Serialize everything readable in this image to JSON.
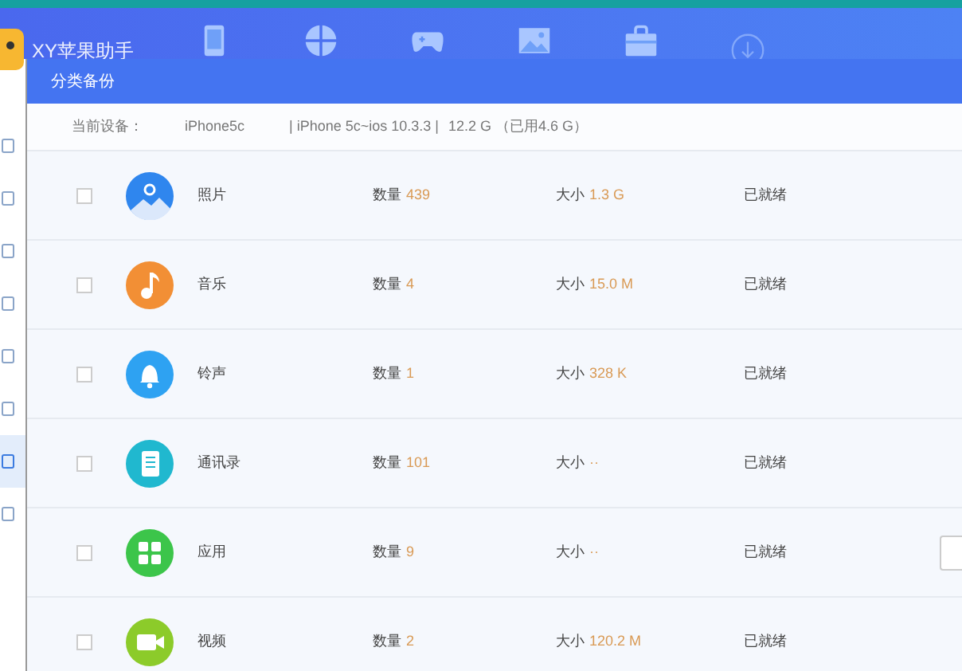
{
  "app": {
    "title": "XY苹果助手"
  },
  "toolbar": [
    {
      "kind": "device",
      "selected": false
    },
    {
      "kind": "apps",
      "selected": false
    },
    {
      "kind": "games",
      "selected": false
    },
    {
      "kind": "wallpaper",
      "selected": false
    },
    {
      "kind": "store",
      "selected": false
    },
    {
      "kind": "download",
      "selected": false
    }
  ],
  "sidebar": {
    "items": [
      {
        "selected": false
      },
      {
        "selected": false
      },
      {
        "selected": false
      },
      {
        "selected": false
      },
      {
        "selected": false
      },
      {
        "selected": false
      },
      {
        "selected": true
      },
      {
        "selected": false
      }
    ]
  },
  "dialog": {
    "title": "分类备份",
    "device": {
      "label": "当前设备：",
      "name": "iPhone5c",
      "model": "| iPhone 5c~ios 10.3.3 |",
      "storage": "12.2 G （已用4.6 G）"
    },
    "rows": [
      {
        "kind": "photo",
        "checked": false,
        "name": "照片",
        "count_label": "数量",
        "count": "439",
        "size_label": "大小",
        "size": "1.3 G",
        "status": "已就绪",
        "action_button": false
      },
      {
        "kind": "music",
        "checked": false,
        "name": "音乐",
        "count_label": "数量",
        "count": "4",
        "size_label": "大小",
        "size": "15.0 M",
        "status": "已就绪",
        "action_button": false
      },
      {
        "kind": "ringtone",
        "checked": false,
        "name": "铃声",
        "count_label": "数量",
        "count": "1",
        "size_label": "大小",
        "size": "328 K",
        "status": "已就绪",
        "action_button": false
      },
      {
        "kind": "contacts",
        "checked": false,
        "name": "通讯录",
        "count_label": "数量",
        "count": "101",
        "size_label": "大小",
        "size": "··",
        "status": "已就绪",
        "action_button": false
      },
      {
        "kind": "apps",
        "checked": false,
        "name": "应用",
        "count_label": "数量",
        "count": "9",
        "size_label": "大小",
        "size": "··",
        "status": "已就绪",
        "action_button": true
      },
      {
        "kind": "video",
        "checked": false,
        "name": "视频",
        "count_label": "数量",
        "count": "2",
        "size_label": "大小",
        "size": "120.2 M",
        "status": "已就绪",
        "action_button": false
      }
    ]
  }
}
